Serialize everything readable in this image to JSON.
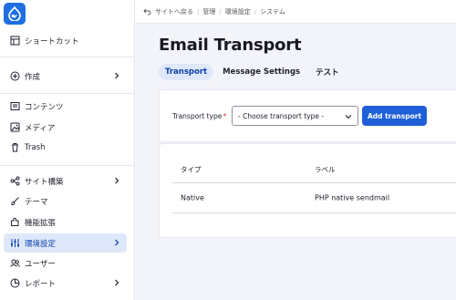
{
  "colors": {
    "accent": "#1f5fd8",
    "active_bg": "#dfe8fb",
    "required": "#d72222"
  },
  "logo": {
    "icon": "drupal-drop-icon"
  },
  "sidebar": {
    "shortcut": "ショートカット",
    "items": [
      {
        "label": "作成",
        "icon": "plus-circle-icon",
        "has_children": true
      },
      {
        "label": "コンテンツ",
        "icon": "content-icon",
        "has_children": false
      },
      {
        "label": "メディア",
        "icon": "media-icon",
        "has_children": false
      },
      {
        "label": "Trash",
        "icon": "trash-icon",
        "has_children": false
      },
      {
        "label": "サイト構築",
        "icon": "structure-icon",
        "has_children": true
      },
      {
        "label": "テーマ",
        "icon": "brush-icon",
        "has_children": false
      },
      {
        "label": "機能拡張",
        "icon": "puzzle-icon",
        "has_children": false
      },
      {
        "label": "環境設定",
        "icon": "sliders-icon",
        "has_children": true,
        "active": true
      },
      {
        "label": "ユーザー",
        "icon": "users-icon",
        "has_children": false
      },
      {
        "label": "レポート",
        "icon": "reports-icon",
        "has_children": true
      }
    ]
  },
  "breadcrumb": {
    "back": "サイトへ戻る",
    "items": [
      "管理",
      "環境設定",
      "システム"
    ]
  },
  "page": {
    "title": "Email Transport",
    "tabs": [
      {
        "label": "Transport",
        "active": true
      },
      {
        "label": "Message Settings",
        "active": false
      },
      {
        "label": "テスト",
        "active": false
      }
    ]
  },
  "form": {
    "transport_type_label": "Transport type",
    "required_mark": "*",
    "select_value": "- Choose transport type -",
    "add_button": "Add transport"
  },
  "table": {
    "headers": [
      "タイプ",
      "ラベル"
    ],
    "rows": [
      [
        "Native",
        "PHP native sendmail"
      ]
    ]
  }
}
